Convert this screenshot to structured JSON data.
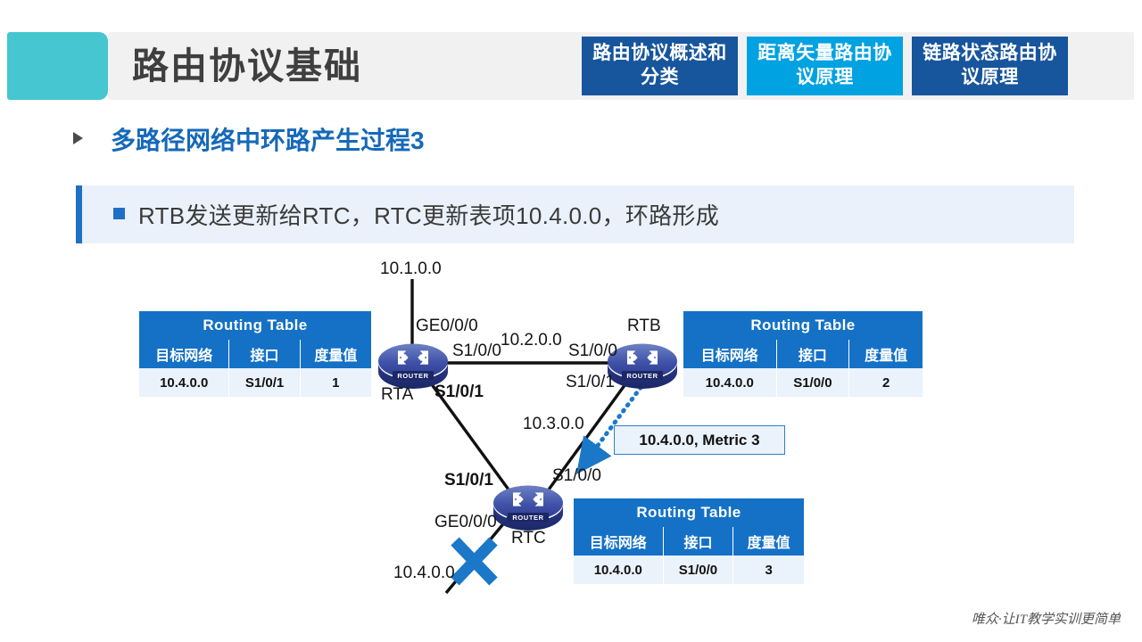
{
  "header": {
    "title": "路由协议基础",
    "accent_teal": "#45c6d0",
    "bar_bg": "#f1f1f1",
    "tabs": [
      {
        "label": "路由协议概述和分类",
        "state": "inactive",
        "color": "#17559c"
      },
      {
        "label": "距离矢量路由协议原理",
        "state": "active",
        "color": "#00a2e1"
      },
      {
        "label": "链路状态路由协议原理",
        "state": "inactive",
        "color": "#17559c"
      }
    ]
  },
  "section": {
    "title": "多路径网络中环路产生过程3",
    "title_color": "#1569b8",
    "bullet_text": "RTB发送更新给RTC，RTC更新表项10.4.0.0，环路形成",
    "band_bg": "#eaf1fa",
    "band_accent": "#1f6fc4"
  },
  "tables": {
    "title": "Routing Table",
    "columns": [
      "目标网络",
      "接口",
      "度量值"
    ],
    "rta": {
      "row": [
        "10.4.0.0",
        "S1/0/1",
        "1"
      ]
    },
    "rtb": {
      "row": [
        "10.4.0.0",
        "S1/0/0",
        "2"
      ]
    },
    "rtc": {
      "row": [
        "10.4.0.0",
        "S1/0/0",
        "3"
      ]
    }
  },
  "topology": {
    "routers": [
      {
        "id": "rta",
        "name": "RTA"
      },
      {
        "id": "rtb",
        "name": "RTB"
      },
      {
        "id": "rtc",
        "name": "RTC"
      }
    ],
    "router_badge": "ROUTER",
    "networks": {
      "n1": "10.1.0.0",
      "n2": "10.2.0.0",
      "n3": "10.3.0.0",
      "n4": "10.4.0.0"
    },
    "interfaces": {
      "rta_ge": "GE0/0/0",
      "rta_s100": "S1/0/0",
      "rta_s101": "S1/0/1",
      "rtb_s100": "S1/0/0",
      "rtb_s101": "S1/0/1",
      "rtc_s101": "S1/0/1",
      "rtc_s100": "S1/0/0",
      "rtc_ge": "GE0/0/0"
    },
    "update_message": "10.4.0.0, Metric 3",
    "link_down_marker": "x-cross",
    "update_arrow_color": "#1b78c8",
    "link_down_color": "#1b78c8"
  },
  "footer": {
    "text": "唯众·让IT教学实训更简单"
  }
}
